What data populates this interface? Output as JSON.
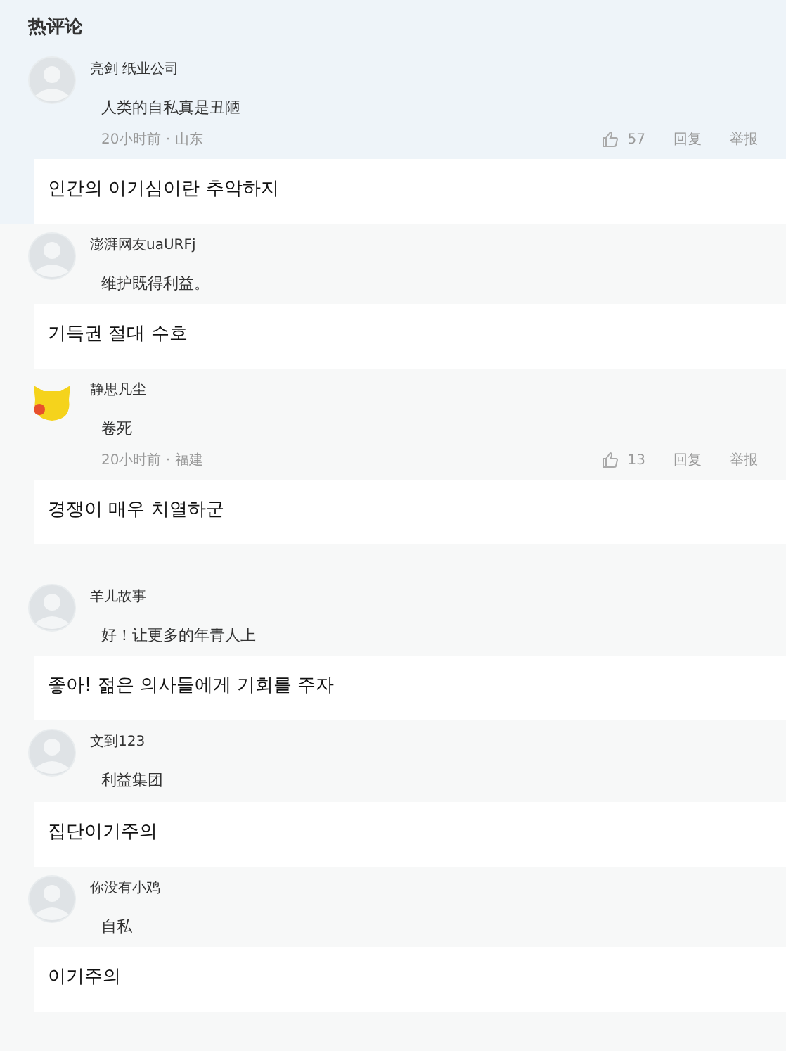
{
  "heading": "热评论",
  "comments": [
    {
      "kind": "default",
      "user": "亮剑 纸业公司",
      "text": "人类的自私真是丑陋",
      "meta": {
        "time": "20小时前 · 山东",
        "likes": "57",
        "reply": "回复",
        "report": "举报"
      },
      "translation": "인간의 이기심이란 추악하지"
    },
    {
      "kind": "default",
      "user": "澎湃网友uaURFj",
      "text": "维护既得利益。",
      "translation": "기득권 절대 수호"
    },
    {
      "kind": "cartoon",
      "user": "静思凡尘",
      "text": "卷死",
      "meta": {
        "time": "20小时前 · 福建",
        "likes": "13",
        "reply": "回复",
        "report": "举报"
      },
      "translation": "경쟁이 매우 치열하군"
    },
    {
      "kind": "default",
      "user": "羊儿故事",
      "text": "好！让更多的年青人上",
      "translation": "좋아! 젊은 의사들에게 기회를 주자"
    },
    {
      "kind": "default",
      "user": "文到123",
      "text": "利益集团",
      "translation": "집단이기주의"
    },
    {
      "kind": "default",
      "user": "你没有小鸡",
      "text": "自私",
      "translation": "이기주의"
    }
  ]
}
